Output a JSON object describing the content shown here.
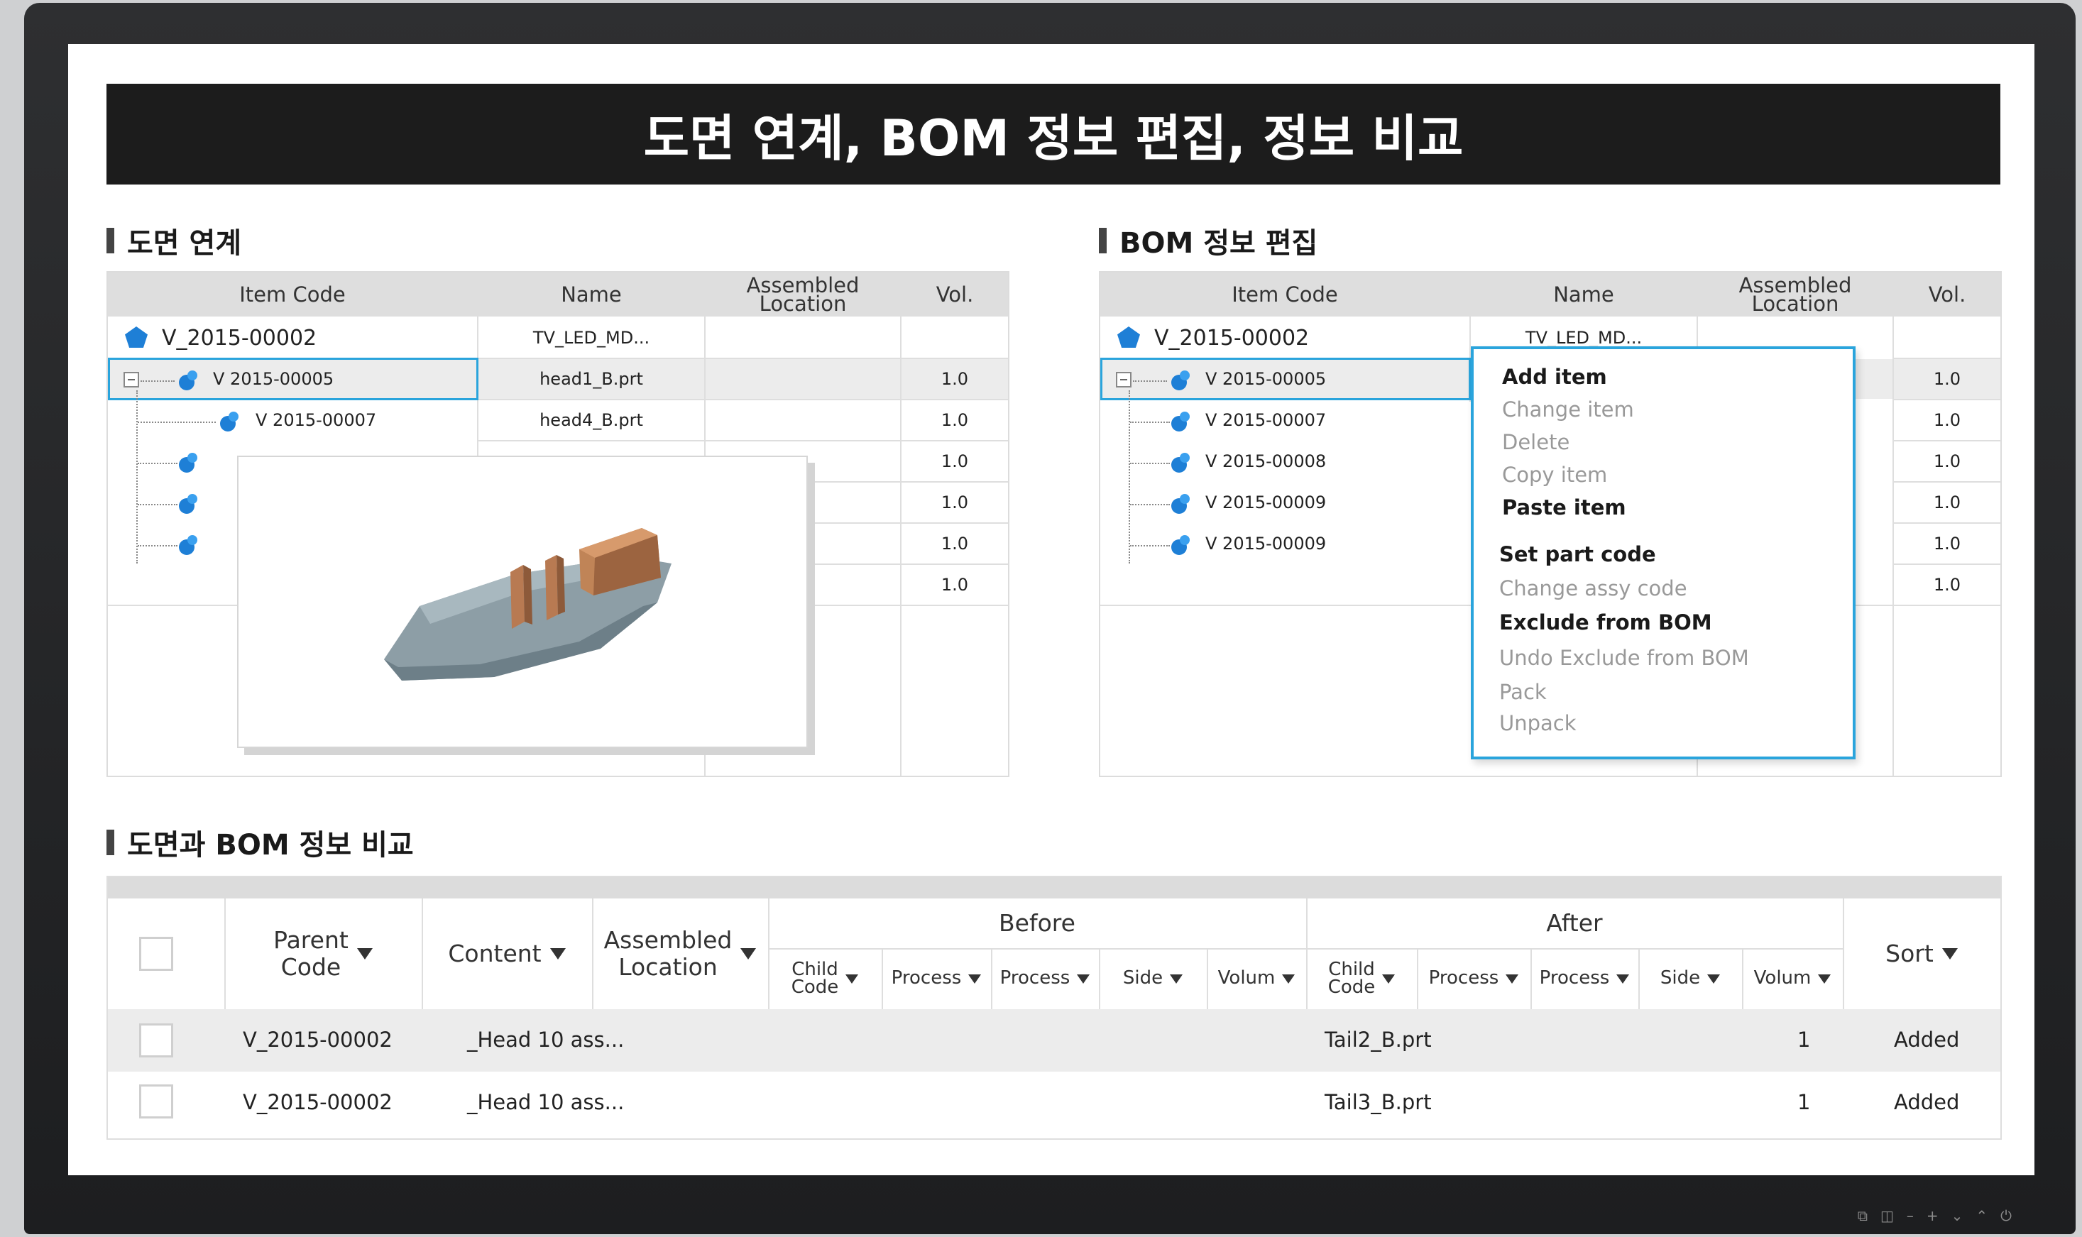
{
  "page_title": "도면 연계, BOM 정보 편집, 정보 비교",
  "left_panel": {
    "section_title": "도면 연계",
    "columns": [
      "Item Code",
      "Name",
      "Assembled\nLocation",
      "Vol."
    ],
    "top_item": {
      "code": "V_2015-00002",
      "name": "TV_LED_MD..."
    },
    "rows": [
      {
        "code": "V 2015-00005",
        "name": "head1_B.prt",
        "vol": "1.0"
      },
      {
        "code": "V 2015-00007",
        "name": "head4_B.prt",
        "vol": "1.0"
      },
      {
        "code": "",
        "name": "",
        "vol": "1.0"
      },
      {
        "code": "",
        "name": "",
        "vol": "1.0"
      },
      {
        "code": "",
        "name": "",
        "vol": "1.0"
      },
      {
        "code": "",
        "name": "",
        "vol": "1.0"
      }
    ]
  },
  "right_panel": {
    "section_title": "BOM 정보 편집",
    "columns": [
      "Item Code",
      "Name",
      "Assembled\nLocation",
      "Vol."
    ],
    "top_item": {
      "code": "V_2015-00002",
      "name": "TV_LED_MD..."
    },
    "rows": [
      {
        "code": "V 2015-00005",
        "vol": "1.0"
      },
      {
        "code": "V 2015-00007",
        "vol": "1.0"
      },
      {
        "code": "V 2015-00008",
        "vol": "1.0"
      },
      {
        "code": "V 2015-00009",
        "vol": "1.0"
      },
      {
        "code": "V 2015-00009",
        "vol": "1.0"
      },
      {
        "code": "",
        "vol": "1.0"
      }
    ],
    "context_menu": [
      {
        "label": "Add item",
        "enabled": true
      },
      {
        "label": "Change item",
        "enabled": false
      },
      {
        "label": "Delete",
        "enabled": false
      },
      {
        "label": "Copy item",
        "enabled": false
      },
      {
        "label": "Paste item",
        "enabled": true
      },
      {
        "label": "Set part code",
        "enabled": true
      },
      {
        "label": "Change assy code",
        "enabled": false
      },
      {
        "label": "Exclude from BOM",
        "enabled": true
      },
      {
        "label": "Undo Exclude from BOM",
        "enabled": false
      },
      {
        "label": "Pack",
        "enabled": false
      },
      {
        "label": "Unpack",
        "enabled": false
      }
    ]
  },
  "compare": {
    "section_title": "도면과 BOM 정보 비교",
    "headers": {
      "parent_code": "Parent\nCode",
      "content": "Content",
      "assembled_location": "Assembled\nLocation",
      "before": "Before",
      "after": "After",
      "sort": "Sort",
      "before_sub": [
        "Child\nCode",
        "Process",
        "Process",
        "Side",
        "Volum"
      ],
      "after_sub": [
        "Child\nCode",
        "Process",
        "Process",
        "Side",
        "Volum"
      ]
    },
    "rows": [
      {
        "parent_code": "V_2015-00002",
        "content": "_Head 10 ass...",
        "after_child": "Tail2_B.prt",
        "after_volum": "1",
        "sort": "Added"
      },
      {
        "parent_code": "V_2015-00002",
        "content": "_Head 10 ass...",
        "after_child": "Tail3_B.prt",
        "after_volum": "1",
        "sort": "Added"
      }
    ]
  },
  "colors": {
    "accent": "#2aa4dc",
    "node_blue": "#1e7fd6",
    "title_bg": "#1c1c1c"
  }
}
